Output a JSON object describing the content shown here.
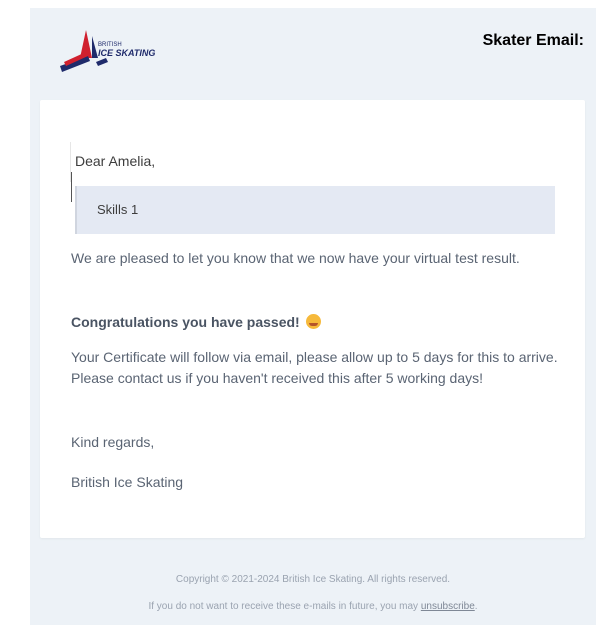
{
  "header": {
    "logo_text": "BRITISH ICE SKATING",
    "label": "Skater Email:"
  },
  "email": {
    "greeting": "Dear Amelia,",
    "test_name": "Skills 1",
    "para1": "We are pleased to let you know that we now have your virtual test result.",
    "para2": "Congratulations you have passed!",
    "para3": "Your Certificate will follow via email, please allow up to 5 days for this to arrive. Please contact us if you haven't received this after 5 working days!",
    "signoff": "Kind regards,",
    "signature": "British Ice Skating"
  },
  "footer": {
    "copyright": "Copyright © 2021-2024 British Ice Skating. All rights reserved.",
    "unsubscribe_prefix": "If you do not want to receive these e-mails in future, you may ",
    "unsubscribe_link": "unsubscribe",
    "unsubscribe_suffix": "."
  },
  "colors": {
    "background": "#edf2f7",
    "card": "#ffffff",
    "logo_red": "#d0202e",
    "logo_navy": "#1f2b6b"
  }
}
